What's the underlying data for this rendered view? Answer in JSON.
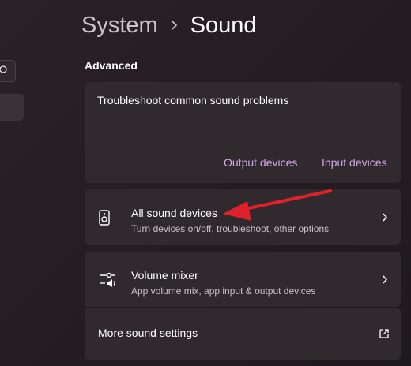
{
  "breadcrumb": {
    "parent": "System",
    "current": "Sound"
  },
  "section": {
    "title": "Advanced"
  },
  "troubleshoot": {
    "title": "Troubleshoot common sound problems",
    "links": {
      "output": "Output devices",
      "input": "Input devices"
    }
  },
  "rows": {
    "all_sound_devices": {
      "title": "All sound devices",
      "subtitle": "Turn devices on/off, troubleshoot, other options",
      "icon": "speaker-device-icon"
    },
    "volume_mixer": {
      "title": "Volume mixer",
      "subtitle": "App volume mix, app input & output devices",
      "icon": "volume-mixer-icon"
    },
    "more_settings": {
      "title": "More sound settings",
      "icon": "open-external-icon"
    }
  },
  "colors": {
    "accent_link": "#d6a6e8",
    "annotation_arrow": "#e0202a",
    "card": "#302a2e"
  }
}
